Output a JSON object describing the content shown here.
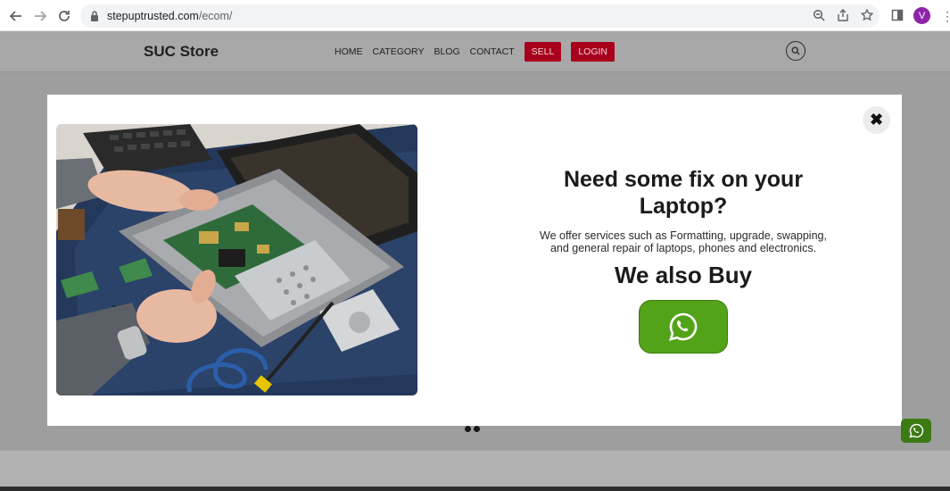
{
  "browser": {
    "url_host": "stepuptrusted.com",
    "url_path": "/ecom/",
    "profile_initial": "V"
  },
  "site": {
    "brand": "SUC Store",
    "nav": [
      "HOME",
      "CATEGORY",
      "BLOG",
      "CONTACT"
    ],
    "sell_label": "SELL",
    "login_label": "LOGIN"
  },
  "modal": {
    "title": "Need some fix on your Laptop?",
    "description_line1": "We offer services such as Formatting, upgrade, swapping,",
    "description_line2": "and general repair of laptops, phones and electronics.",
    "subtitle": "We also Buy",
    "close_symbol": "✖"
  },
  "colors": {
    "whatsapp_green": "#52a318",
    "nav_red": "#a8001c",
    "overlay_gray": "#9e9e9e"
  }
}
